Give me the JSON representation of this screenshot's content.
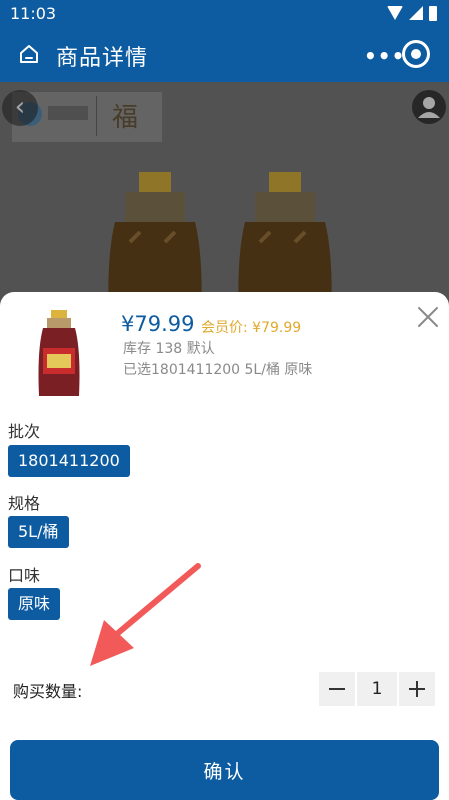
{
  "status_bar": {
    "time": "11:03"
  },
  "nav": {
    "title": "商品详情",
    "more_label": "•••"
  },
  "sku": {
    "price": "¥79.99",
    "member_price": "会员价: ¥79.99",
    "stock": "库存 138 默认",
    "selected": "已选1801411200 5L/桶 原味"
  },
  "attributes": [
    {
      "label": "批次",
      "value": "1801411200"
    },
    {
      "label": "规格",
      "value": "5L/桶"
    },
    {
      "label": "口味",
      "value": "原味"
    }
  ],
  "quantity": {
    "label": "购买数量:",
    "value": "1"
  },
  "confirm_label": "确认",
  "icons": [
    "home-icon",
    "more-icon",
    "record-icon",
    "back-arrow-icon",
    "user-icon",
    "close-icon",
    "minus-icon",
    "plus-icon"
  ],
  "colors": {
    "brand": "#0d5ba1",
    "member_price": "#e0a92c",
    "annotation_arrow": "#f25a5a"
  }
}
